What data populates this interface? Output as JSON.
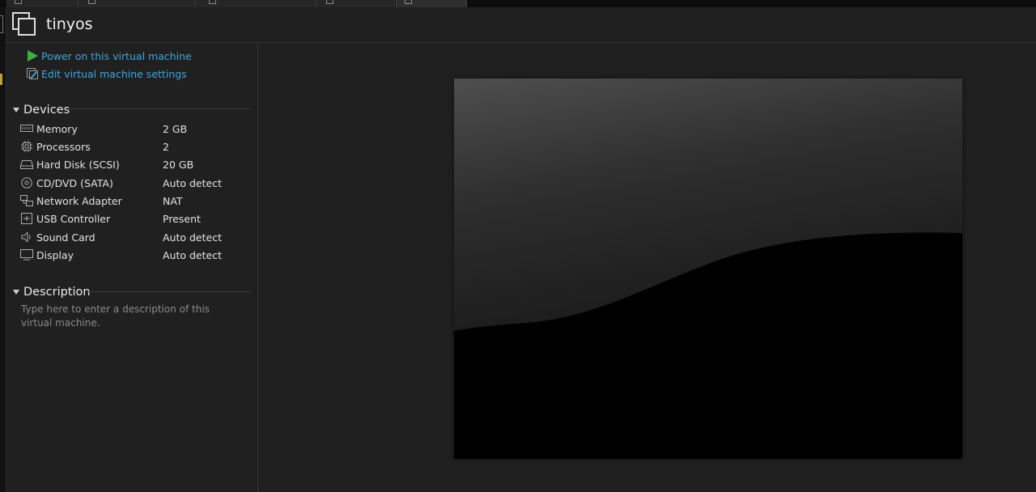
{
  "window": {
    "title": "tinyos"
  },
  "actions": {
    "power_on": "Power on this virtual machine",
    "edit_settings": "Edit virtual machine settings"
  },
  "devices": {
    "heading": "Devices",
    "items": [
      {
        "name": "Memory",
        "value": "2 GB",
        "icon": "memory-icon"
      },
      {
        "name": "Processors",
        "value": "2",
        "icon": "processor-icon"
      },
      {
        "name": "Hard Disk (SCSI)",
        "value": "20 GB",
        "icon": "hard-disk-icon"
      },
      {
        "name": "CD/DVD (SATA)",
        "value": "Auto detect",
        "icon": "cd-dvd-icon"
      },
      {
        "name": "Network Adapter",
        "value": "NAT",
        "icon": "network-adapter-icon"
      },
      {
        "name": "USB Controller",
        "value": "Present",
        "icon": "usb-controller-icon"
      },
      {
        "name": "Sound Card",
        "value": "Auto detect",
        "icon": "sound-card-icon"
      },
      {
        "name": "Display",
        "value": "Auto detect",
        "icon": "display-icon"
      }
    ]
  },
  "description": {
    "heading": "Description",
    "placeholder": "Type here to enter a description of this virtual machine."
  },
  "colors": {
    "background": "#202020",
    "link": "#3da6e0",
    "power_green": "#3cb043"
  }
}
